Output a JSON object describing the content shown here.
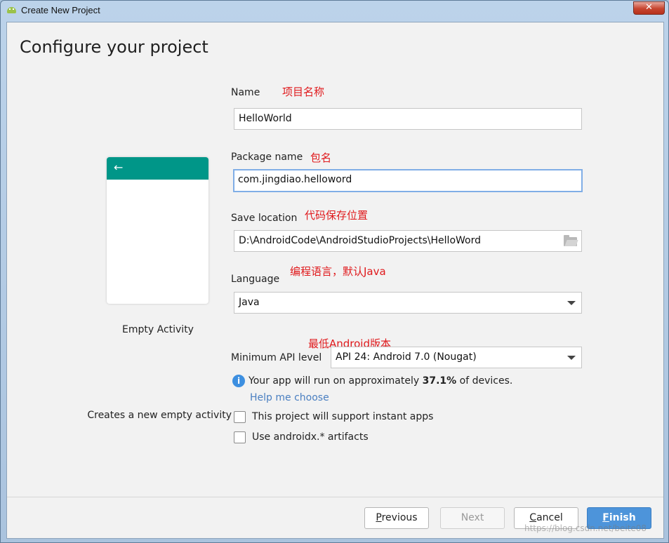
{
  "window": {
    "title": "Create New Project",
    "close_label": "✕"
  },
  "page": {
    "title": "Configure your project"
  },
  "template": {
    "name": "Empty Activity",
    "description": "Creates a new empty activity",
    "toolbar_color": "#009688"
  },
  "fields": {
    "name": {
      "label": "Name",
      "value": "HelloWorld",
      "note": "项目名称"
    },
    "package": {
      "label": "Package name",
      "value": "com.jingdiao.helloword",
      "note": "包名"
    },
    "save_location": {
      "label": "Save location",
      "value": "D:\\AndroidCode\\AndroidStudioProjects\\HelloWord",
      "note": "代码保存位置"
    },
    "language": {
      "label": "Language",
      "value": "Java",
      "note": "编程语言，默认Java"
    },
    "min_api": {
      "label": "Minimum API level",
      "value": "API 24: Android 7.0 (Nougat)",
      "note": "最低Android版本"
    }
  },
  "info": {
    "prefix": "Your app will run on approximately ",
    "percent": "37.1%",
    "suffix": " of devices.",
    "help_link": "Help me choose"
  },
  "checkboxes": [
    {
      "label": "This project will support instant apps",
      "checked": false
    },
    {
      "label": "Use androidx.* artifacts",
      "checked": false
    }
  ],
  "buttons": {
    "previous": {
      "mnemonic": "P",
      "rest": "revious"
    },
    "next": "Next",
    "cancel": {
      "mnemonic": "C",
      "rest": "ancel"
    },
    "finish": {
      "mnemonic": "F",
      "rest": "inish"
    }
  },
  "watermark": "https://blog.csdn.net/beite08",
  "colors": {
    "accent": "#4d94da",
    "note": "#e0191c",
    "link": "#4a7fc1"
  }
}
